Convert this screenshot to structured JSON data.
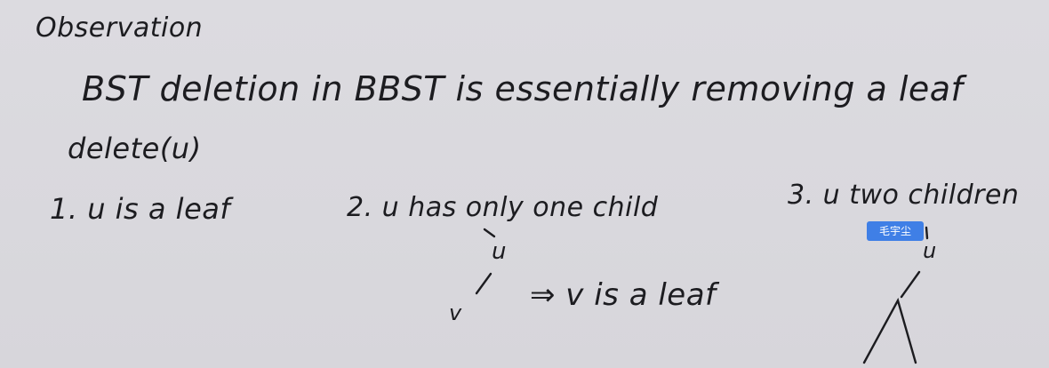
{
  "page": {
    "title": "Observation",
    "statement": "BST deletion in BBST is essentially removing a leaf",
    "call": "delete(u)"
  },
  "cases": {
    "case1": "1. u is a leaf",
    "case2": "2. u has only one child",
    "case3": "3. u two children"
  },
  "tree": {
    "case2_parent": "u",
    "case2_child": "v",
    "case2_result": "⇒ v is a leaf",
    "case3_node": "u"
  },
  "overlay": {
    "name_tag": "毛宇尘"
  },
  "colors": {
    "background": "#d9d8dd",
    "ink": "#1c1c20",
    "tag": "#3f7fe6"
  }
}
